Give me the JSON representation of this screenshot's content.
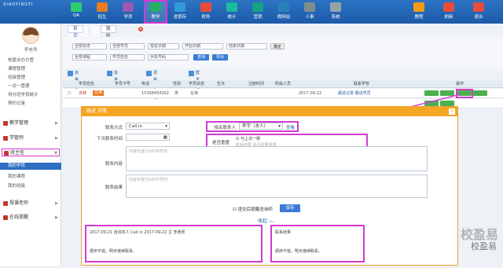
{
  "app": {
    "name": "校盈易",
    "subtitle": "XIAOYINGYI"
  },
  "nav": [
    {
      "label": "OA",
      "icon": "oa-icon"
    },
    {
      "label": "招生",
      "icon": "recruit-icon"
    },
    {
      "label": "学员",
      "icon": "student-icon"
    },
    {
      "label": "教学",
      "icon": "teaching-icon"
    },
    {
      "label": "进销存",
      "icon": "inventory-icon"
    },
    {
      "label": "财务",
      "icon": "finance-icon"
    },
    {
      "label": "统计",
      "icon": "stats-icon"
    },
    {
      "label": "营销",
      "icon": "marketing-icon"
    },
    {
      "label": "微网站",
      "icon": "website-icon"
    },
    {
      "label": "人事",
      "icon": "hr-icon"
    },
    {
      "label": "系统",
      "icon": "system-icon"
    }
  ],
  "nav_right": [
    {
      "label": "教程"
    },
    {
      "label": "刷新"
    },
    {
      "label": "退出"
    }
  ],
  "sidebar": {
    "user": "李老师",
    "items": [
      "校盈业办方管",
      "课程管理",
      "班级管理",
      "一对一管理",
      "待分班学员统计",
      "预约记录"
    ],
    "sections": [
      "教学管理",
      "学管师",
      "班主任",
      "授课老师",
      "在线提醒"
    ],
    "sub": [
      "我的学员",
      "我的课程",
      "我的班级"
    ]
  },
  "tabs": [
    "首页",
    "我的学员"
  ],
  "filters": {
    "row1": [
      "全部状态",
      "全部学员",
      "报名日期",
      "开始日期",
      "结束日期",
      "确定"
    ],
    "row2": [
      "全部课程",
      "学员姓名",
      "手机号码",
      "查询",
      "导出"
    ]
  },
  "toolbar": [
    "批量删除",
    "批量转班",
    "调整学管师",
    "群发短信"
  ],
  "table": {
    "headers": [
      "",
      "学员姓名",
      "学员卡号",
      "电话",
      "性别",
      "学员状态",
      "生日",
      "注册时间",
      "所属人员",
      "联系学管",
      "操作"
    ],
    "row": {
      "name": "洪菲",
      "status": "在读",
      "phone": "15368454302",
      "gender": "男",
      "state": "在读",
      "date": "2017-09-22",
      "note": "跟进记录 跟进学员"
    }
  },
  "modal": {
    "title": "跟进 详情",
    "contact_method_label": "联系方式",
    "contact_method": "Call in",
    "next_contact_label": "下次联系时间",
    "content_label": "联系内容",
    "content_placeholder": "内容长度为180字符内",
    "result_label": "联系结果",
    "result_placeholder": "内容长度为180字符内",
    "related_label": "相关联系人",
    "related_value": "李宇（本人）",
    "related_button": "查看",
    "sync_label": "是否重置",
    "sync_check": "与上次一致",
    "sync_hint": "联系结果 是否需要重置",
    "remind_label": "提交后提醒咨询师",
    "save": "保存",
    "collapse": "收起",
    "record_left": "2017-09-21 咨询本人 Call in 2017-09-22 主 李老师",
    "record_left_note": "顺序不错，明天继续联系。",
    "record_right": "联系结果",
    "record_right_note": "顺序不错，明天继续联系。"
  },
  "watermark": {
    "logo": "校盈易",
    "caption": "校盈易"
  },
  "colors": {
    "top": "#1b5aa8",
    "accent": "#d23ad0",
    "modal": "#f5a623"
  }
}
